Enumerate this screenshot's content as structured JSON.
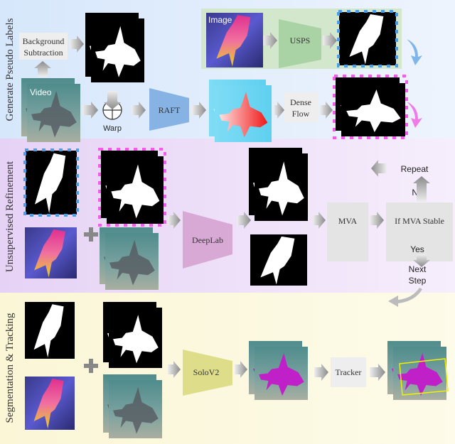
{
  "sections": {
    "generate": {
      "label": "Generate Pseudo Labels",
      "color": "#dcebfb"
    },
    "refine": {
      "label": "Unsupervised Refinement",
      "color": "#ecdcf7"
    },
    "track": {
      "label": "Segmentation & Tracking",
      "color": "#fbf8da"
    }
  },
  "generate": {
    "background_subtraction": [
      "Background",
      "Subtraction"
    ],
    "video_label": "Video",
    "warp_label": "Warp",
    "raft_label": "RAFT",
    "dense_flow": [
      "Dense",
      "Flow"
    ],
    "image_label": "Image",
    "usps_label": "USPS"
  },
  "refine": {
    "deeplab_label": "DeepLab",
    "mva_label": "MVA",
    "stable_label": "If MVA Stable",
    "repeat_label": "Repeat",
    "no_label": "No",
    "yes_label": "Yes",
    "next_step": [
      "Next",
      "Step"
    ]
  },
  "track": {
    "solov2_label": "SoloV2",
    "tracker_label": "Tracker"
  },
  "colors": {
    "usps_panel": "#d3e7cc",
    "usps_block": "#a9d3a4",
    "raft_block": "#86b3e3",
    "deeplab_block": "#d9a9d6",
    "solov2_block": "#dede8a",
    "blue_dash": "#4a9ee8",
    "pink_dash": "#f25ce8",
    "segment_mask": "#c020c8",
    "tracker_box": "#f0f000"
  }
}
